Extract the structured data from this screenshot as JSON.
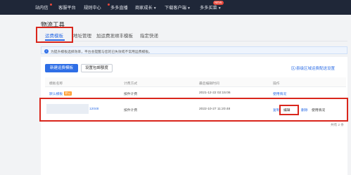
{
  "topbar": {
    "items": [
      {
        "label": "站内信"
      },
      {
        "label": "客服平台"
      },
      {
        "label": "规则中心"
      },
      {
        "label": "多多直播"
      },
      {
        "label": "商家成长"
      },
      {
        "label": "下载客户端"
      },
      {
        "label": "多多买菜"
      }
    ],
    "new_badge": "NEW"
  },
  "page_title": "物流工具",
  "tabs": [
    {
      "label": "运费模板"
    },
    {
      "label": "地址管理"
    },
    {
      "label": "加运费发顺丰模板"
    },
    {
      "label": "指定快递"
    }
  ],
  "notice": {
    "text": "为提升模板选择效率，平台会提醒与您的已失效或不常用运费模板。"
  },
  "toolbar": {
    "new_template": "新建运费模板",
    "set_free_shipping": "设置包邮额度",
    "region_link": "区/县级区域运费配送设置"
  },
  "table": {
    "headers": [
      "模板名称",
      "计费方式",
      "最后编辑时间",
      "操作"
    ],
    "rows": [
      {
        "name": "默认模板",
        "tag": "默认",
        "billing": "按件计费",
        "time": "2021-12-22 02:15:06",
        "actions": [
          "使用情况"
        ]
      },
      {
        "name": "12048",
        "billing": "按件计费",
        "time": "2022-10-27 11:20:48",
        "actions": [
          "复制",
          "编辑",
          "删除",
          "使用情况"
        ]
      }
    ]
  },
  "footer": {
    "total": "共有 2 条"
  }
}
